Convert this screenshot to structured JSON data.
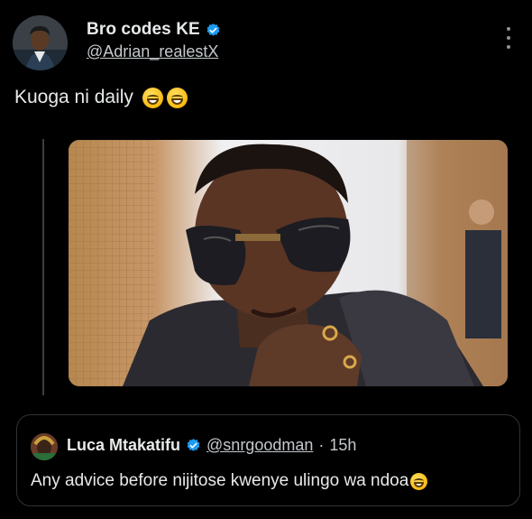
{
  "author": {
    "display_name": "Bro codes KE",
    "handle": "@Adrian_realestX",
    "verified": true
  },
  "tweet": {
    "text": "Kuoga ni daily",
    "emojis": [
      "grinning-sweat-emoji",
      "grinning-sweat-emoji"
    ]
  },
  "media": {
    "subject": "photo"
  },
  "quoted_tweet": {
    "display_name": "Luca Mtakatifu",
    "handle": "@snrgoodman",
    "separator": "·",
    "time": "15h",
    "verified": true,
    "text": "Any advice before nijitose kwenye ulingo wa ndoa",
    "emojis": [
      "grinning-sweat-emoji"
    ]
  },
  "colors": {
    "background": "#000000",
    "text": "#e7e9ea",
    "secondary_text": "#c4c9cd",
    "verified_blue": "#1d9bf0",
    "border": "#2f3336"
  },
  "icons": [
    "verified-badge-icon",
    "more-options-icon"
  ]
}
